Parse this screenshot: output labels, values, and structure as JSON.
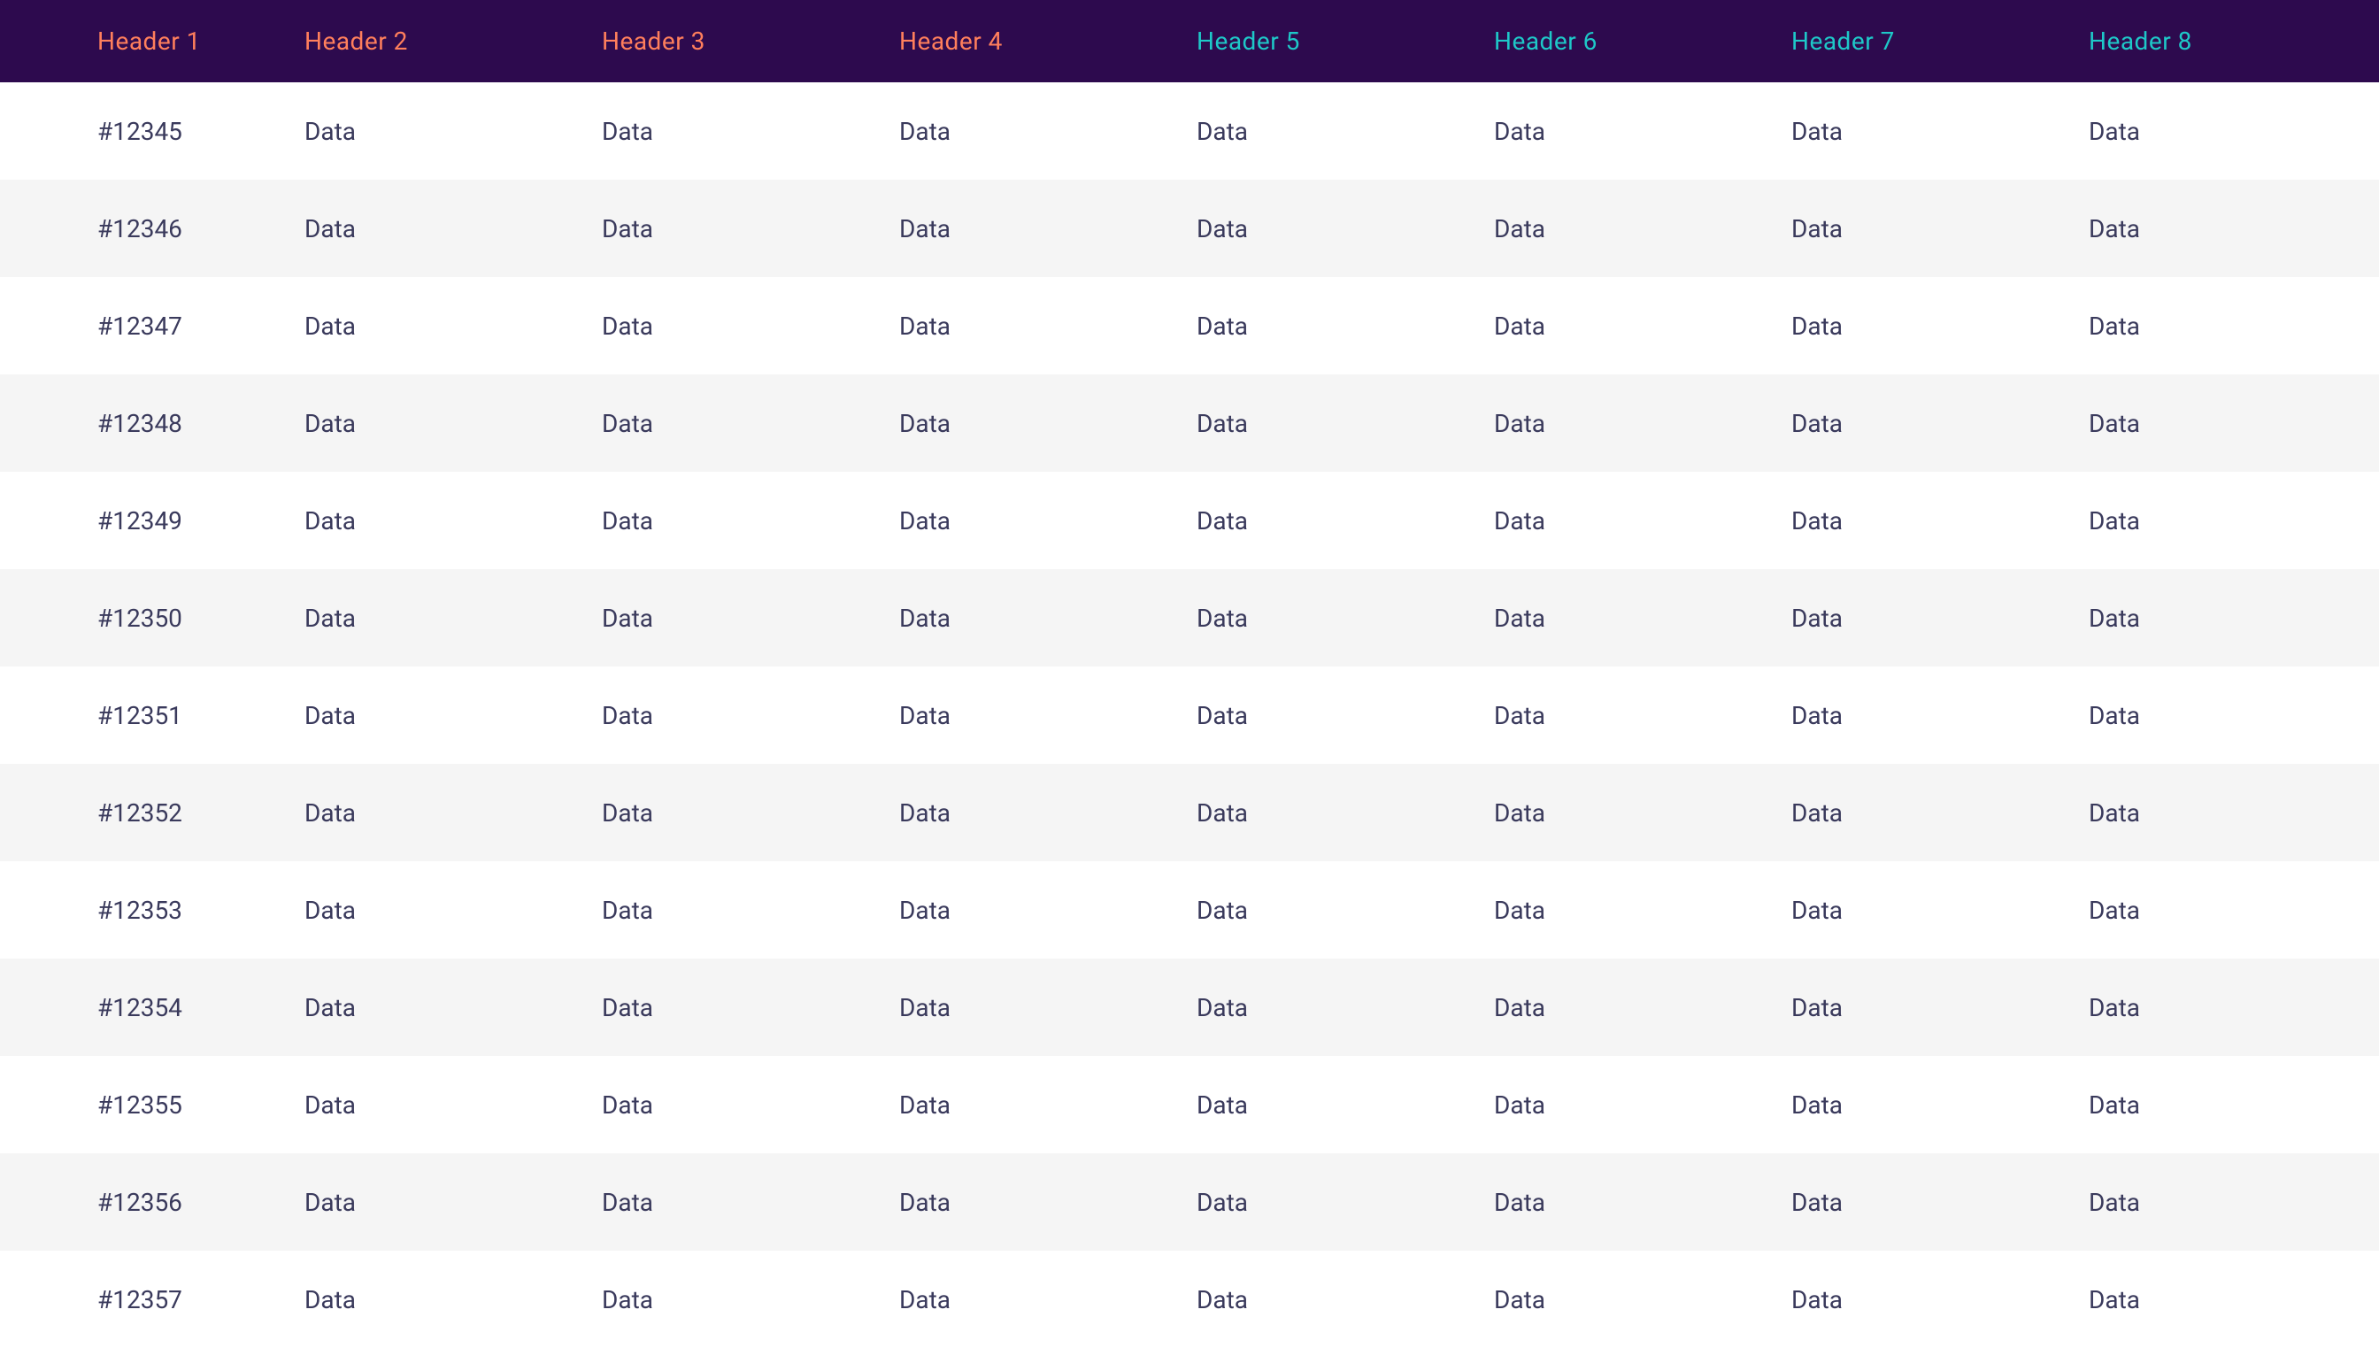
{
  "table": {
    "headers": [
      {
        "label": "Header 1",
        "variant": "coral"
      },
      {
        "label": "Header 2",
        "variant": "coral"
      },
      {
        "label": "Header 3",
        "variant": "coral"
      },
      {
        "label": "Header 4",
        "variant": "coral"
      },
      {
        "label": "Header 5",
        "variant": "teal"
      },
      {
        "label": "Header 6",
        "variant": "teal"
      },
      {
        "label": "Header 7",
        "variant": "teal"
      },
      {
        "label": "Header 8",
        "variant": "teal"
      }
    ],
    "rows": [
      {
        "id": "#12345",
        "cells": [
          "Data",
          "Data",
          "Data",
          "Data",
          "Data",
          "Data",
          "Data"
        ]
      },
      {
        "id": "#12346",
        "cells": [
          "Data",
          "Data",
          "Data",
          "Data",
          "Data",
          "Data",
          "Data"
        ]
      },
      {
        "id": "#12347",
        "cells": [
          "Data",
          "Data",
          "Data",
          "Data",
          "Data",
          "Data",
          "Data"
        ]
      },
      {
        "id": "#12348",
        "cells": [
          "Data",
          "Data",
          "Data",
          "Data",
          "Data",
          "Data",
          "Data"
        ]
      },
      {
        "id": "#12349",
        "cells": [
          "Data",
          "Data",
          "Data",
          "Data",
          "Data",
          "Data",
          "Data"
        ]
      },
      {
        "id": "#12350",
        "cells": [
          "Data",
          "Data",
          "Data",
          "Data",
          "Data",
          "Data",
          "Data"
        ]
      },
      {
        "id": "#12351",
        "cells": [
          "Data",
          "Data",
          "Data",
          "Data",
          "Data",
          "Data",
          "Data"
        ]
      },
      {
        "id": "#12352",
        "cells": [
          "Data",
          "Data",
          "Data",
          "Data",
          "Data",
          "Data",
          "Data"
        ]
      },
      {
        "id": "#12353",
        "cells": [
          "Data",
          "Data",
          "Data",
          "Data",
          "Data",
          "Data",
          "Data"
        ]
      },
      {
        "id": "#12354",
        "cells": [
          "Data",
          "Data",
          "Data",
          "Data",
          "Data",
          "Data",
          "Data"
        ]
      },
      {
        "id": "#12355",
        "cells": [
          "Data",
          "Data",
          "Data",
          "Data",
          "Data",
          "Data",
          "Data"
        ]
      },
      {
        "id": "#12356",
        "cells": [
          "Data",
          "Data",
          "Data",
          "Data",
          "Data",
          "Data",
          "Data"
        ]
      },
      {
        "id": "#12357",
        "cells": [
          "Data",
          "Data",
          "Data",
          "Data",
          "Data",
          "Data",
          "Data"
        ]
      }
    ]
  },
  "colors": {
    "headerBg": "#2d0a4e",
    "coral": "#ff7f5c",
    "teal": "#1ec8c8",
    "rowOdd": "#ffffff",
    "rowEven": "#f5f5f5",
    "cellText": "#3a3a5c"
  }
}
